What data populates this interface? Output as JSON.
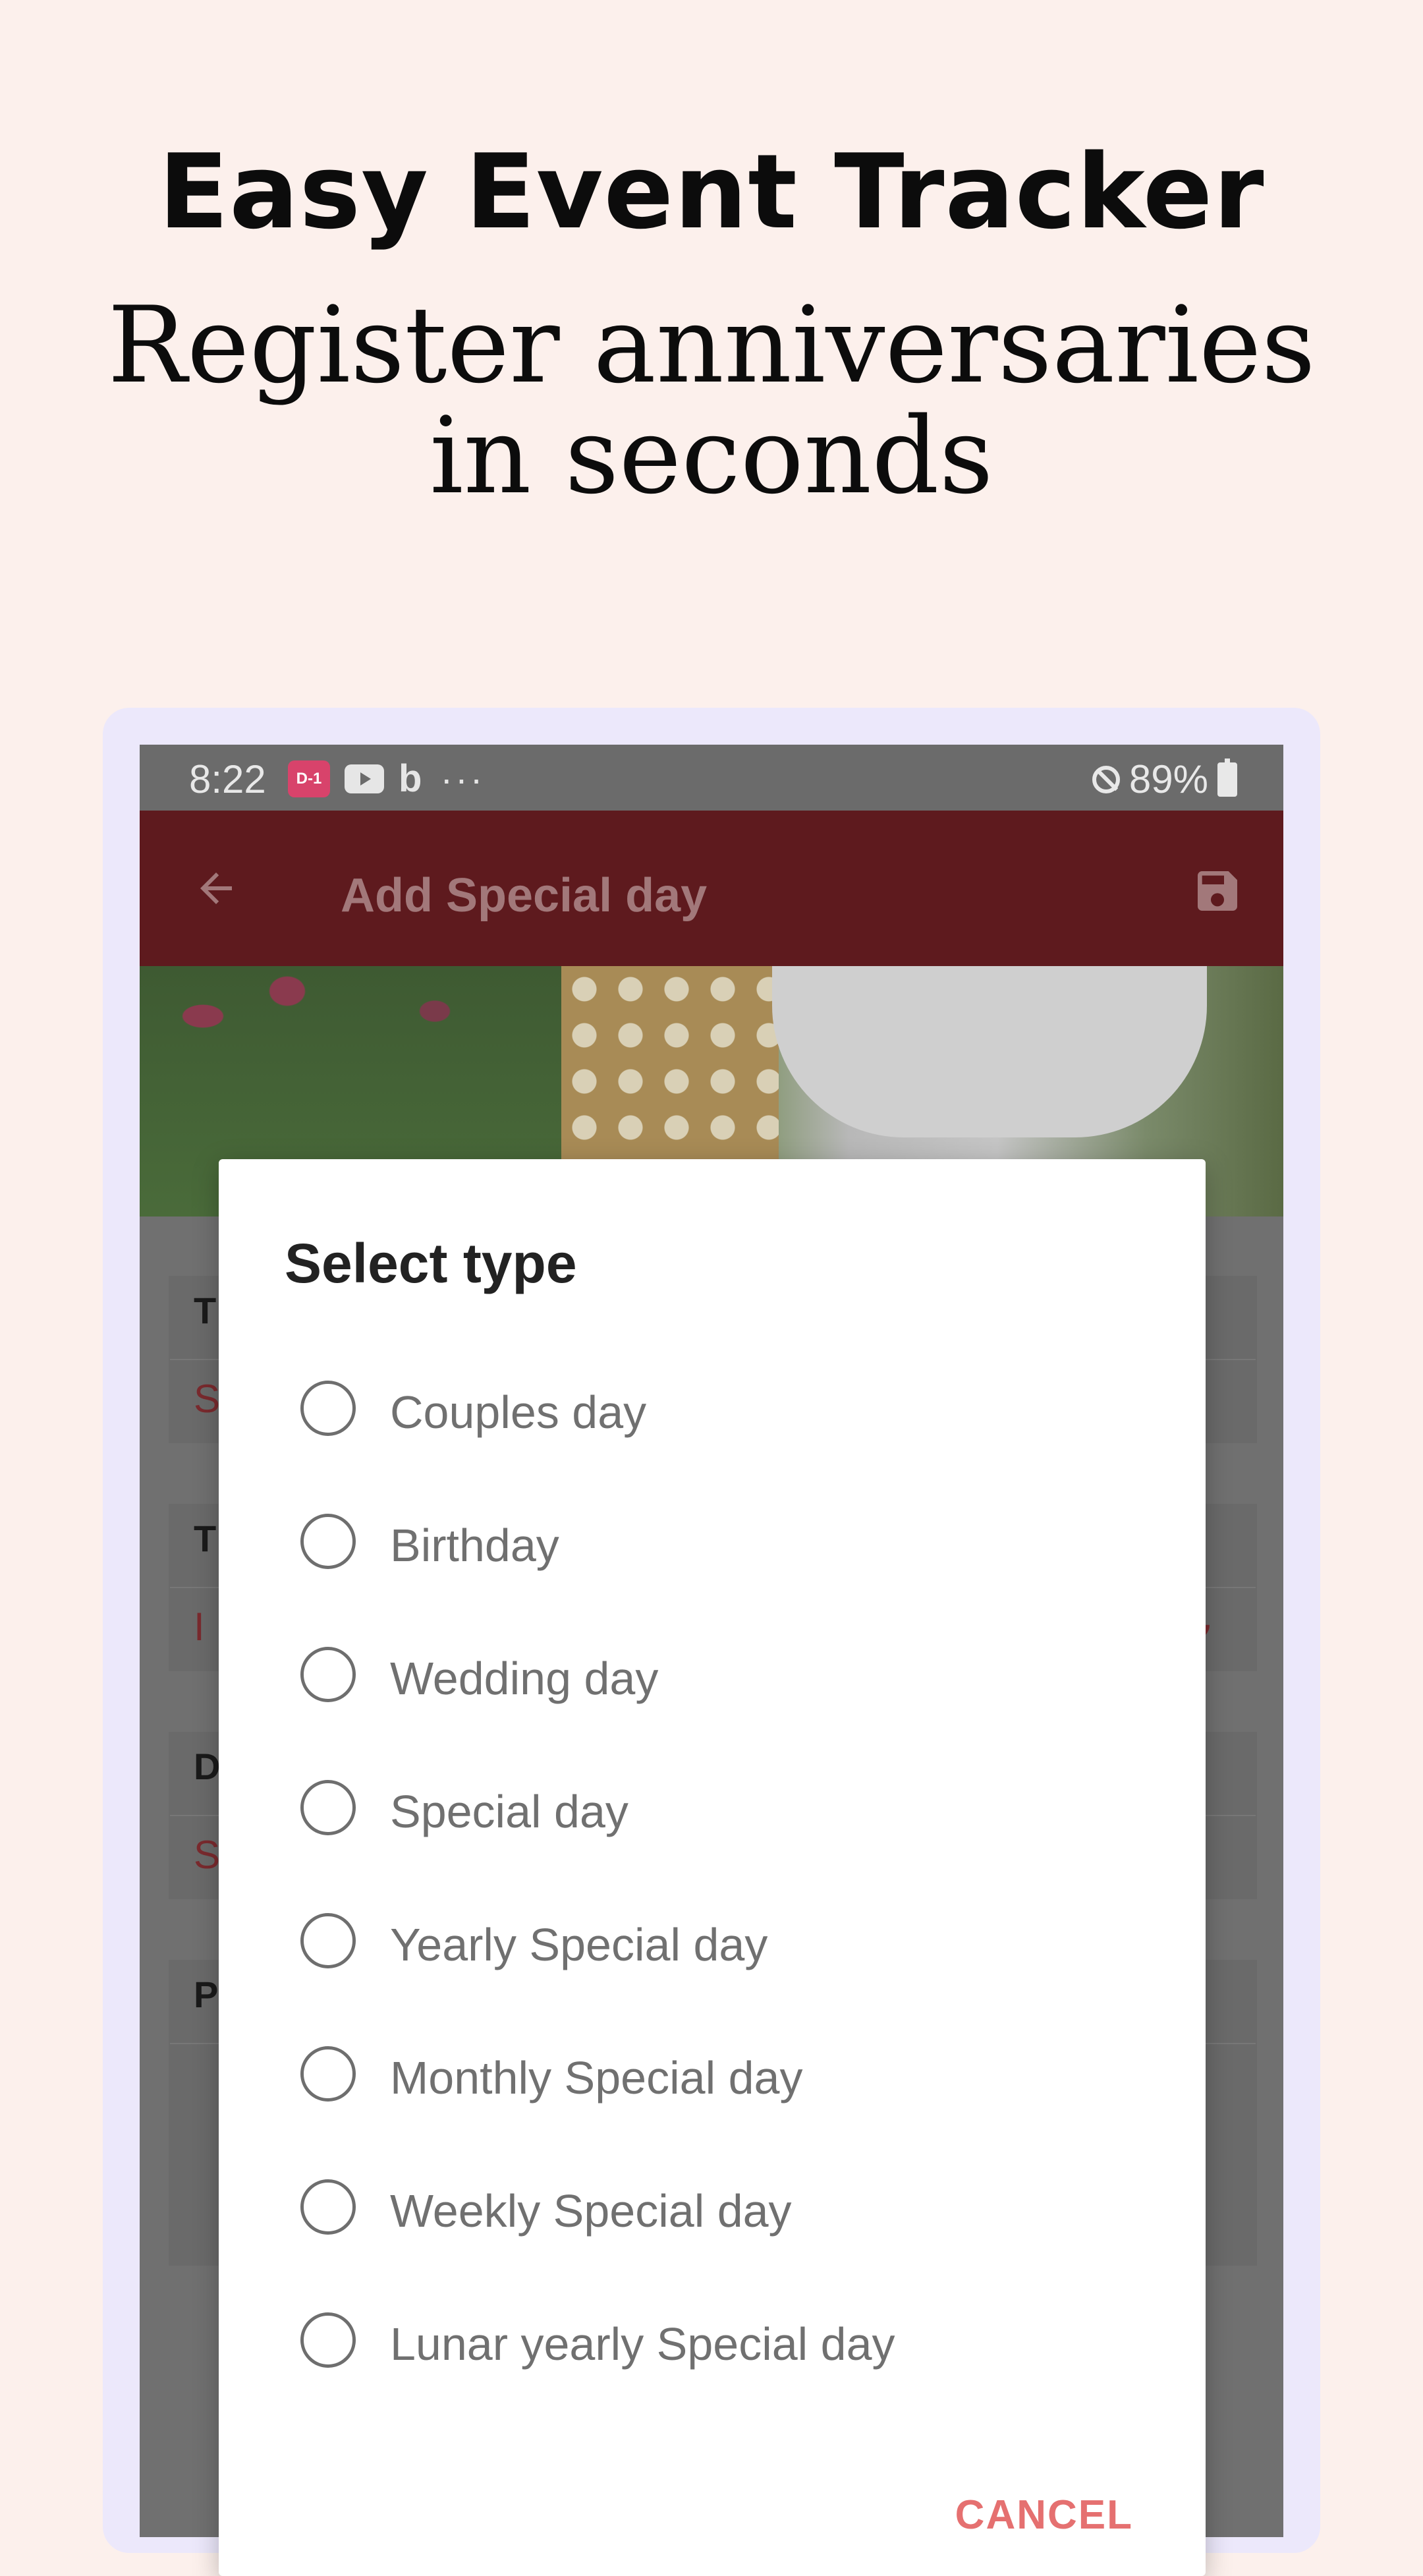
{
  "promo": {
    "headline": "Easy Event Tracker",
    "subhead_line1": "Register anniversaries",
    "subhead_line2": "in seconds"
  },
  "status_bar": {
    "time": "8:22",
    "app_badge": "D-1",
    "battery": "89%",
    "icons": [
      "app-heart-icon",
      "youtube-icon",
      "bing-icon",
      "more-dots-icon",
      "do-not-disturb-icon",
      "battery-charging-icon"
    ]
  },
  "app_bar": {
    "title": "Add Special day",
    "icons": [
      "back-arrow-icon",
      "save-icon"
    ]
  },
  "dialog": {
    "title": "Select type",
    "options": [
      {
        "label": "Couples day"
      },
      {
        "label": "Birthday"
      },
      {
        "label": "Wedding day"
      },
      {
        "label": "Special day"
      },
      {
        "label": "Yearly Special day"
      },
      {
        "label": "Monthly Special day"
      },
      {
        "label": "Weekly Special day"
      },
      {
        "label": "Lunar yearly Special day"
      }
    ],
    "cancel_label": "CANCEL"
  },
  "background_form": {
    "field_labels": [
      "T",
      "T",
      "D",
      "P"
    ],
    "field_values": [
      "S",
      "I",
      "S",
      ""
    ]
  },
  "colors": {
    "page_bg": "#fcf0ec",
    "frame_bg": "#ece8fb",
    "app_bar": "#5e1a1e",
    "cancel": "#e57070"
  }
}
